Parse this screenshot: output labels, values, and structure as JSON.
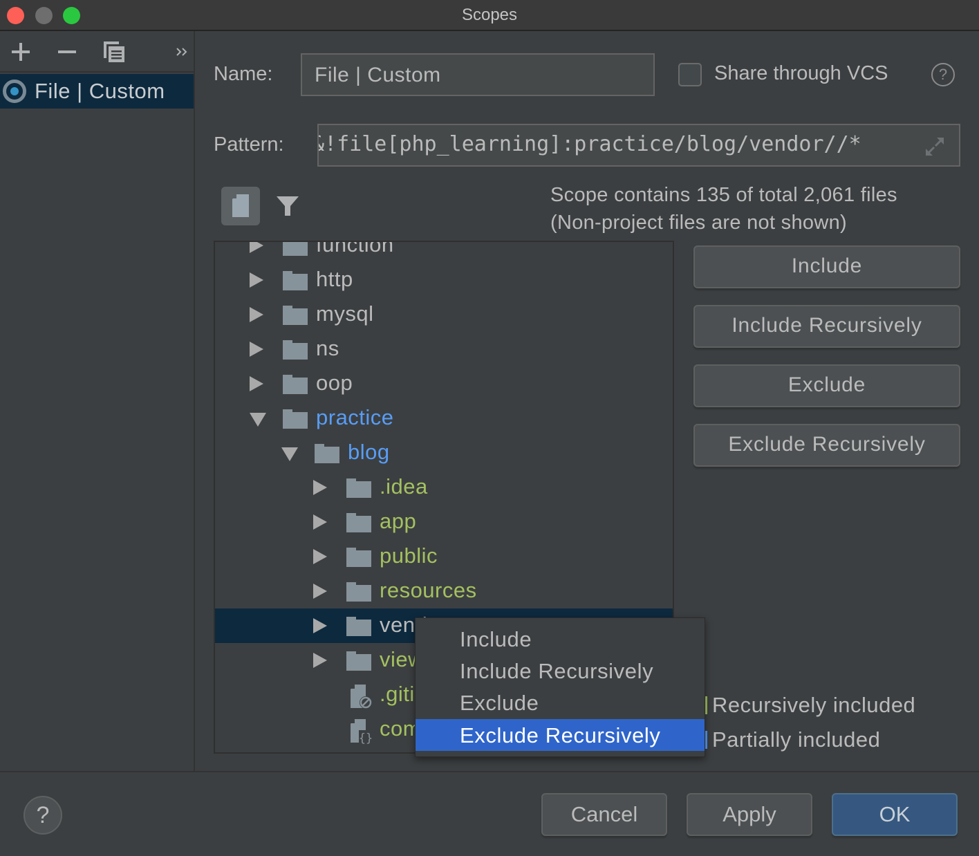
{
  "window": {
    "title": "Scopes"
  },
  "sidebar": {
    "toolbar": [
      {
        "name": "add-scope-button",
        "icon": "plus-icon",
        "glyph": "+"
      },
      {
        "name": "remove-scope-button",
        "icon": "minus-icon",
        "glyph": "−"
      },
      {
        "name": "copy-scope-button",
        "icon": "copy-icon",
        "glyph": ""
      },
      {
        "name": "more-button",
        "icon": "double-chevron-right-icon",
        "glyph": "»"
      }
    ],
    "items": [
      {
        "label": "File | Custom",
        "icon": "scope-radio-icon",
        "selected": true
      }
    ]
  },
  "form": {
    "name_label": "Name:",
    "name_value": "File | Custom",
    "share_label": "Share through VCS",
    "share_checked": false,
    "help_glyph": "?",
    "pattern_label": "Pattern:",
    "pattern_value": "&!file[php_learning]:practice/blog/vendor//*"
  },
  "scope_info": {
    "line1": "Scope contains 135 of total 2,061 files",
    "line2": "(Non-project files are not shown)"
  },
  "tree": {
    "nodes": [
      {
        "label": "function",
        "depth": 0,
        "type": "folder",
        "state": "collapsed",
        "color": "gray"
      },
      {
        "label": "http",
        "depth": 0,
        "type": "folder",
        "state": "collapsed",
        "color": "gray"
      },
      {
        "label": "mysql",
        "depth": 0,
        "type": "folder",
        "state": "collapsed",
        "color": "gray"
      },
      {
        "label": "ns",
        "depth": 0,
        "type": "folder",
        "state": "collapsed",
        "color": "gray"
      },
      {
        "label": "oop",
        "depth": 0,
        "type": "folder",
        "state": "collapsed",
        "color": "gray"
      },
      {
        "label": "practice",
        "depth": 0,
        "type": "folder",
        "state": "expanded",
        "color": "blue"
      },
      {
        "label": "blog",
        "depth": 1,
        "type": "folder",
        "state": "expanded",
        "color": "blue"
      },
      {
        "label": ".idea",
        "depth": 2,
        "type": "folder",
        "state": "collapsed",
        "color": "green"
      },
      {
        "label": "app",
        "depth": 2,
        "type": "folder",
        "state": "collapsed",
        "color": "green"
      },
      {
        "label": "public",
        "depth": 2,
        "type": "folder",
        "state": "collapsed",
        "color": "green"
      },
      {
        "label": "resources",
        "depth": 2,
        "type": "folder",
        "state": "collapsed",
        "color": "green"
      },
      {
        "label": "vendor",
        "depth": 2,
        "type": "folder",
        "state": "collapsed",
        "color": "gray",
        "selected": true
      },
      {
        "label": "views",
        "depth": 2,
        "type": "folder",
        "state": "collapsed",
        "color": "green"
      },
      {
        "label": ".gitignore",
        "depth": 2,
        "type": "ignore-file",
        "color": "green"
      },
      {
        "label": "composer.json",
        "depth": 2,
        "type": "json-file",
        "color": "green"
      }
    ]
  },
  "actions": {
    "include": "Include",
    "include_recursively": "Include Recursively",
    "exclude": "Exclude",
    "exclude_recursively": "Exclude Recursively"
  },
  "legend": [
    {
      "label": "Recursively included",
      "color": "#a4c160"
    },
    {
      "label": "Partially included",
      "color": "#589df6"
    }
  ],
  "context_menu": {
    "items": [
      {
        "label": "Include",
        "active": false
      },
      {
        "label": "Include Recursively",
        "active": false
      },
      {
        "label": "Exclude",
        "active": false
      },
      {
        "label": "Exclude Recursively",
        "active": true
      }
    ]
  },
  "footer": {
    "help_glyph": "?",
    "cancel": "Cancel",
    "apply": "Apply",
    "ok": "OK"
  },
  "colors": {
    "background": "#3c3f41",
    "selection": "#0d293e",
    "menu_highlight": "#2f65ca",
    "primary_button": "#365880",
    "included_green": "#a4c160",
    "partial_blue": "#589df6"
  }
}
